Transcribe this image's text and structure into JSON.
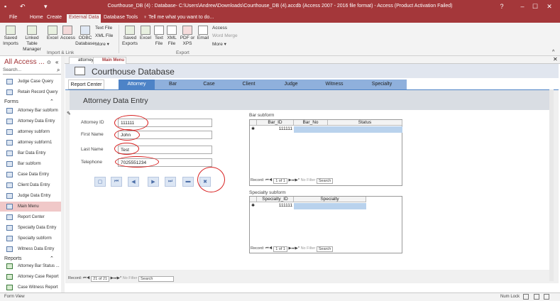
{
  "titlebar": {
    "title": "Courthouse_DB (4) : Database- C:\\Users\\Andrew\\Downloads\\Courthouse_DB (4).accdb (Access 2007 - 2016 file format) - Access (Product Activation Failed)",
    "help": "?",
    "minimize": "–",
    "restore": "☐",
    "close": "✕"
  },
  "ribbon_tabs": [
    "File",
    "Home",
    "Create",
    "External Data",
    "Database Tools",
    "♀ Tell me what you want to do..."
  ],
  "ribbon": {
    "import": {
      "saved_imports": "Saved Imports",
      "linked_table_manager": "Linked Table Manager",
      "excel": "Excel",
      "access": "Access",
      "odbc": "ODBC Database",
      "text_file": "Text File",
      "xml_file": "XML File",
      "more": "More ▾",
      "group": "Import & Link"
    },
    "export": {
      "saved_exports": "Saved Exports",
      "excel": "Excel",
      "text_file": "Text File",
      "xml_file": "XML File",
      "pdf": "PDF or XPS",
      "email": "Email",
      "access": "Access",
      "word_merge": "Word Merge",
      "more": "More ▾",
      "group": "Export"
    }
  },
  "nav": {
    "title": "All Access ...",
    "search_placeholder": "Search...",
    "top_items": [
      "Judge Case Query",
      "Retain Record Query"
    ],
    "forms_label": "Forms",
    "forms": [
      "Attorney Bar subform",
      "Attorney Data Entry",
      "attorney subform",
      "attorney subform1",
      "Bar Data Entry",
      "Bar subform",
      "Case Data Entry",
      "Client Data Entry",
      "Judge Data Entry",
      "Main Menu",
      "Report Center",
      "Specialty Data Entry",
      "Specialty subform",
      "Witness Data Entry"
    ],
    "selected": "Main Menu",
    "reports_label": "Reports",
    "reports": [
      "Attorney Bar Status ...",
      "Attorney Case Report",
      "Case Witness Report"
    ]
  },
  "doc_tabs": [
    "attorney",
    "Main Menu"
  ],
  "form": {
    "title": "Courthouse Database",
    "tabs": [
      "Report Center",
      "Attorney",
      "Bar",
      "Case",
      "Client",
      "Judge",
      "Witness",
      "Specialty"
    ],
    "active_tab": "Attorney",
    "sub_title": "Attorney Data Entry",
    "fields": [
      {
        "label": "Attorney ID",
        "value": "111111"
      },
      {
        "label": "First Name",
        "value": "John"
      },
      {
        "label": "Last Name",
        "value": "Test"
      },
      {
        "label": "Telephone",
        "value": "7025551234"
      }
    ],
    "nav_buttons": [
      "new-record",
      "first",
      "previous",
      "next",
      "last",
      "save",
      "delete"
    ],
    "bar_subform": {
      "label": "Bar subform",
      "headers": [
        "Bar_ID",
        "Bar_No",
        "Status"
      ],
      "row": [
        "111111",
        "",
        ""
      ],
      "record": {
        "label": "Record:",
        "pos": "1 of 1",
        "filter": "No Filter",
        "search": "Search"
      }
    },
    "specialty_subform": {
      "label": "Specialty subform",
      "headers": [
        "Specialty_ID",
        "Specialty"
      ],
      "row": [
        "111111",
        ""
      ],
      "record": {
        "label": "Record:",
        "pos": "1 of 1",
        "filter": "No Filter",
        "search": "Search"
      }
    },
    "record_bar": {
      "label": "Record:",
      "pos": "21 of 21",
      "filter": "No Filter",
      "search": "Search"
    }
  },
  "status": {
    "left": "Form View",
    "numlock": "Num Lock"
  },
  "colors": {
    "access_red": "#a4373a",
    "tab_blue": "#4d83c7",
    "annotation": "#d82020"
  }
}
